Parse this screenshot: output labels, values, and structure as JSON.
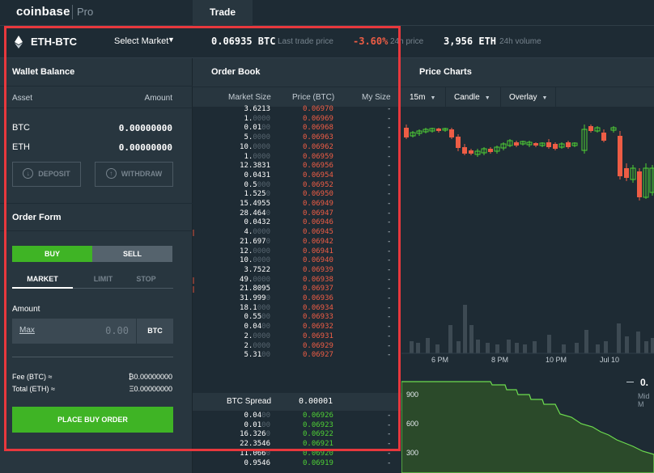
{
  "app": {
    "logo": "coinbase",
    "logo_sub": "Pro",
    "tab": "Trade"
  },
  "market": {
    "pair": "ETH-BTC",
    "select_label": "Select Market",
    "last_price": "0.06935 BTC",
    "last_price_label": "Last trade price",
    "change": "-3.60%",
    "change_label": "24h price",
    "volume": "3,956 ETH",
    "volume_label": "24h volume",
    "change_color": "#ee5d45"
  },
  "wallet": {
    "title": "Wallet Balance",
    "col_asset": "Asset",
    "col_amount": "Amount",
    "rows": [
      {
        "asset": "BTC",
        "amount": "0.00000000"
      },
      {
        "asset": "ETH",
        "amount": "0.00000000"
      }
    ],
    "deposit": "DEPOSIT",
    "withdraw": "WITHDRAW"
  },
  "order_form": {
    "title": "Order Form",
    "buy": "BUY",
    "sell": "SELL",
    "tabs": [
      "MARKET",
      "LIMIT",
      "STOP"
    ],
    "amount_label": "Amount",
    "max": "Max",
    "amount_value": "0.00",
    "amount_unit": "BTC",
    "fee_label": "Fee (BTC) ≈",
    "fee_value": "₿0.00000000",
    "total_label": "Total (ETH) ≈",
    "total_value": "Ξ0.00000000",
    "submit": "PLACE BUY ORDER",
    "buy_color": "#3fb425"
  },
  "order_book": {
    "title": "Order Book",
    "col_size": "Market Size",
    "col_price": "Price (BTC)",
    "col_my": "My Size",
    "asks": [
      {
        "size": "3.6213",
        "price": "0.06970",
        "my": "-"
      },
      {
        "size": "1.0000",
        "price": "0.06969",
        "my": "-"
      },
      {
        "size": "0.0100",
        "price": "0.06968",
        "my": "-"
      },
      {
        "size": "5.0000",
        "price": "0.06963",
        "my": "-"
      },
      {
        "size": "10.0000",
        "price": "0.06962",
        "my": "-"
      },
      {
        "size": "1.0000",
        "price": "0.06959",
        "my": "-"
      },
      {
        "size": "12.3831",
        "price": "0.06956",
        "my": "-"
      },
      {
        "size": "0.0431",
        "price": "0.06954",
        "my": "-"
      },
      {
        "size": "0.5000",
        "price": "0.06952",
        "my": "-"
      },
      {
        "size": "1.5250",
        "price": "0.06950",
        "my": "-"
      },
      {
        "size": "15.4955",
        "price": "0.06949",
        "my": "-"
      },
      {
        "size": "28.4640",
        "price": "0.06947",
        "my": "-"
      },
      {
        "size": "0.0432",
        "price": "0.06946",
        "my": "-"
      },
      {
        "size": "4.0000",
        "price": "0.06945",
        "my": "-"
      },
      {
        "size": "21.6970",
        "price": "0.06942",
        "my": "-"
      },
      {
        "size": "12.0000",
        "price": "0.06941",
        "my": "-"
      },
      {
        "size": "10.0000",
        "price": "0.06940",
        "my": "-"
      },
      {
        "size": "3.7522",
        "price": "0.06939",
        "my": "-"
      },
      {
        "size": "49.0000",
        "price": "0.06938",
        "my": "-"
      },
      {
        "size": "21.8095",
        "price": "0.06937",
        "my": "-"
      },
      {
        "size": "31.9990",
        "price": "0.06936",
        "my": "-"
      },
      {
        "size": "18.1000",
        "price": "0.06934",
        "my": "-"
      },
      {
        "size": "0.5500",
        "price": "0.06933",
        "my": "-"
      },
      {
        "size": "0.0400",
        "price": "0.06932",
        "my": "-"
      },
      {
        "size": "2.0000",
        "price": "0.06931",
        "my": "-"
      },
      {
        "size": "2.0000",
        "price": "0.06929",
        "my": "-"
      },
      {
        "size": "5.3100",
        "price": "0.06927",
        "my": "-"
      }
    ],
    "spread_label": "BTC Spread",
    "spread_value": "0.00001",
    "bids": [
      {
        "size": "0.0400",
        "price": "0.06926",
        "my": "-"
      },
      {
        "size": "0.0100",
        "price": "0.06923",
        "my": "-"
      },
      {
        "size": "16.3260",
        "price": "0.06922",
        "my": "-"
      },
      {
        "size": "22.3546",
        "price": "0.06921",
        "my": "-"
      },
      {
        "size": "11.0660",
        "price": "0.06920",
        "my": "-"
      },
      {
        "size": "0.9546",
        "price": "0.06919",
        "my": "-"
      }
    ],
    "ask_color": "#ee5d45",
    "bid_color": "#4fcf35"
  },
  "charts": {
    "title": "Price Charts",
    "interval": "15m",
    "chart_type": "Candle",
    "overlay": "Overlay",
    "time_labels": [
      "6 PM",
      "8 PM",
      "10 PM",
      "Jul 10"
    ],
    "depth_labels": [
      "900",
      "600",
      "300"
    ],
    "mid_value": "0.",
    "mid_label": "Mid M"
  }
}
